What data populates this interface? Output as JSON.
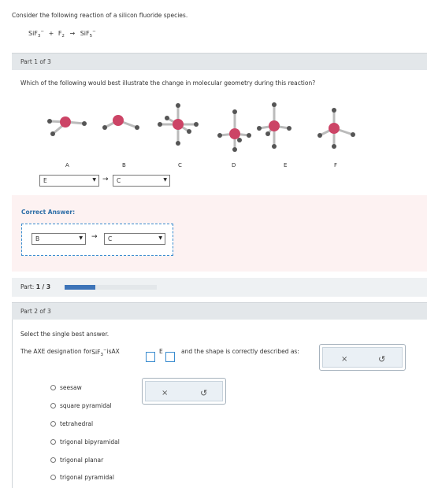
{
  "intro": {
    "text": "Consider the following reaction of a silicon fluoride species.",
    "reaction": {
      "r1_base": "SiF",
      "r1_sub": "3",
      "r1_sup": "−",
      "plus": "+",
      "r2_base": "F",
      "r2_sub": "2",
      "arrow": "→",
      "p_base": "SiF",
      "p_sub": "5",
      "p_sup": "−"
    }
  },
  "part1": {
    "header": "Part 1 of 3",
    "question": "Which of the following would best illustrate the change in molecular geometry during this reaction?",
    "molecules": [
      {
        "label": "A",
        "icon": "t-shaped-molecule-icon"
      },
      {
        "label": "B",
        "icon": "bent-molecule-icon"
      },
      {
        "label": "C",
        "icon": "octahedral-molecule-icon"
      },
      {
        "label": "D",
        "icon": "trigonal-bipyramidal-molecule-icon"
      },
      {
        "label": "E",
        "icon": "square-pyramidal-molecule-icon"
      },
      {
        "label": "F",
        "icon": "seesaw-molecule-icon"
      }
    ],
    "answer_from": "E",
    "answer_to": "C",
    "arrow": "→",
    "correct_label": "Correct Answer:",
    "correct_from": "B",
    "correct_to": "C"
  },
  "progress": {
    "prefix": "Part: ",
    "value": "1 / 3",
    "fraction": 0.33,
    "fill_color": "#3d74b8",
    "track_color": "#e3e7ea"
  },
  "part2": {
    "header": "Part 2 of 3",
    "instruction": "Select the single best answer.",
    "axe_prefix": "The AXE designation for ",
    "axe_formula_base": "SiF",
    "axe_formula_sub": "3",
    "axe_formula_sup": "−",
    "axe_is": " is ",
    "axe_a": "AX",
    "axe_e": "E",
    "axe_suffix": "and the shape is correctly described as:",
    "options": [
      "seesaw",
      "square pyramidal",
      "tetrahedral",
      "trigonal bipyramidal",
      "trigonal planar",
      "trigonal pyramidal"
    ],
    "clear_symbol": "×",
    "undo_symbol": "↺"
  },
  "colors": {
    "central_atom": "#cc4466",
    "ligand": "#555555",
    "bond": "#bbbbbb",
    "correct_bg": "#fdf2f2",
    "input_border": "#3a8ccf"
  }
}
